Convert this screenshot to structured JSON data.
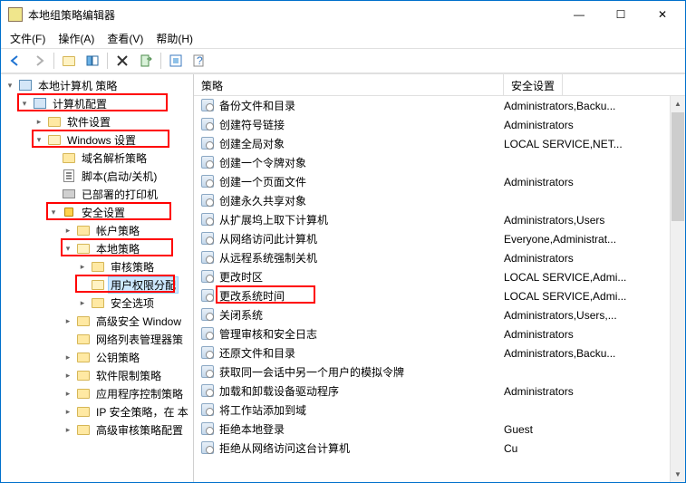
{
  "window": {
    "title": "本地组策略编辑器",
    "minimize": "—",
    "maximize": "☐",
    "close": "✕"
  },
  "menu": {
    "file": "文件(F)",
    "action": "操作(A)",
    "view": "查看(V)",
    "help": "帮助(H)"
  },
  "toolbar_icons": [
    "back-arrow-icon",
    "forward-arrow-icon",
    "up-icon",
    "show-hide-tree-icon",
    "properties-icon",
    "delete-icon",
    "export-icon",
    "refresh-icon",
    "help-icon"
  ],
  "tree": {
    "root": "本地计算机 策略",
    "nodes": [
      {
        "indent": 0,
        "exp": "▾",
        "icon": "comp",
        "label": "本地计算机 策略"
      },
      {
        "indent": 1,
        "exp": "▾",
        "icon": "comp",
        "label": "计算机配置",
        "hl": true
      },
      {
        "indent": 2,
        "exp": "▸",
        "icon": "folder",
        "label": "软件设置"
      },
      {
        "indent": 2,
        "exp": "▾",
        "icon": "folder-o",
        "label": "Windows 设置",
        "hl": true
      },
      {
        "indent": 3,
        "exp": "",
        "icon": "folder",
        "label": "域名解析策略"
      },
      {
        "indent": 3,
        "exp": "",
        "icon": "script",
        "label": "脚本(启动/关机)"
      },
      {
        "indent": 3,
        "exp": "",
        "icon": "printer",
        "label": "已部署的打印机"
      },
      {
        "indent": 3,
        "exp": "▾",
        "icon": "lock",
        "label": "安全设置",
        "hl": true
      },
      {
        "indent": 4,
        "exp": "▸",
        "icon": "folder",
        "label": "帐户策略"
      },
      {
        "indent": 4,
        "exp": "▾",
        "icon": "folder-o",
        "label": "本地策略",
        "hl": true
      },
      {
        "indent": 5,
        "exp": "▸",
        "icon": "folder",
        "label": "审核策略"
      },
      {
        "indent": 5,
        "exp": "",
        "icon": "folder-o",
        "label": "用户权限分配",
        "hl": true,
        "selected": true
      },
      {
        "indent": 5,
        "exp": "▸",
        "icon": "folder",
        "label": "安全选项"
      },
      {
        "indent": 4,
        "exp": "▸",
        "icon": "folder",
        "label": "高级安全 Window"
      },
      {
        "indent": 4,
        "exp": "",
        "icon": "folder",
        "label": "网络列表管理器策"
      },
      {
        "indent": 4,
        "exp": "▸",
        "icon": "folder",
        "label": "公钥策略"
      },
      {
        "indent": 4,
        "exp": "▸",
        "icon": "folder",
        "label": "软件限制策略"
      },
      {
        "indent": 4,
        "exp": "▸",
        "icon": "folder",
        "label": "应用程序控制策略"
      },
      {
        "indent": 4,
        "exp": "▸",
        "icon": "folder",
        "label": "IP 安全策略，在 本"
      },
      {
        "indent": 4,
        "exp": "▸",
        "icon": "folder",
        "label": "高级审核策略配置"
      }
    ]
  },
  "list": {
    "col1": "策略",
    "col2": "安全设置",
    "rows": [
      {
        "policy": "备份文件和目录",
        "setting": "Administrators,Backu..."
      },
      {
        "policy": "创建符号链接",
        "setting": "Administrators"
      },
      {
        "policy": "创建全局对象",
        "setting": "LOCAL SERVICE,NET..."
      },
      {
        "policy": "创建一个令牌对象",
        "setting": ""
      },
      {
        "policy": "创建一个页面文件",
        "setting": "Administrators"
      },
      {
        "policy": "创建永久共享对象",
        "setting": ""
      },
      {
        "policy": "从扩展坞上取下计算机",
        "setting": "Administrators,Users"
      },
      {
        "policy": "从网络访问此计算机",
        "setting": "Everyone,Administrat..."
      },
      {
        "policy": "从远程系统强制关机",
        "setting": "Administrators"
      },
      {
        "policy": "更改时区",
        "setting": "LOCAL SERVICE,Admi..."
      },
      {
        "policy": "更改系统时间",
        "setting": "LOCAL SERVICE,Admi...",
        "hl": true
      },
      {
        "policy": "关闭系统",
        "setting": "Administrators,Users,..."
      },
      {
        "policy": "管理审核和安全日志",
        "setting": "Administrators"
      },
      {
        "policy": "还原文件和目录",
        "setting": "Administrators,Backu..."
      },
      {
        "policy": "获取同一会话中另一个用户的模拟令牌",
        "setting": ""
      },
      {
        "policy": "加载和卸载设备驱动程序",
        "setting": "Administrators"
      },
      {
        "policy": "将工作站添加到域",
        "setting": ""
      },
      {
        "policy": "拒绝本地登录",
        "setting": "Guest"
      },
      {
        "policy": "拒绝从网络访问这台计算机",
        "setting": "Cu"
      }
    ]
  }
}
